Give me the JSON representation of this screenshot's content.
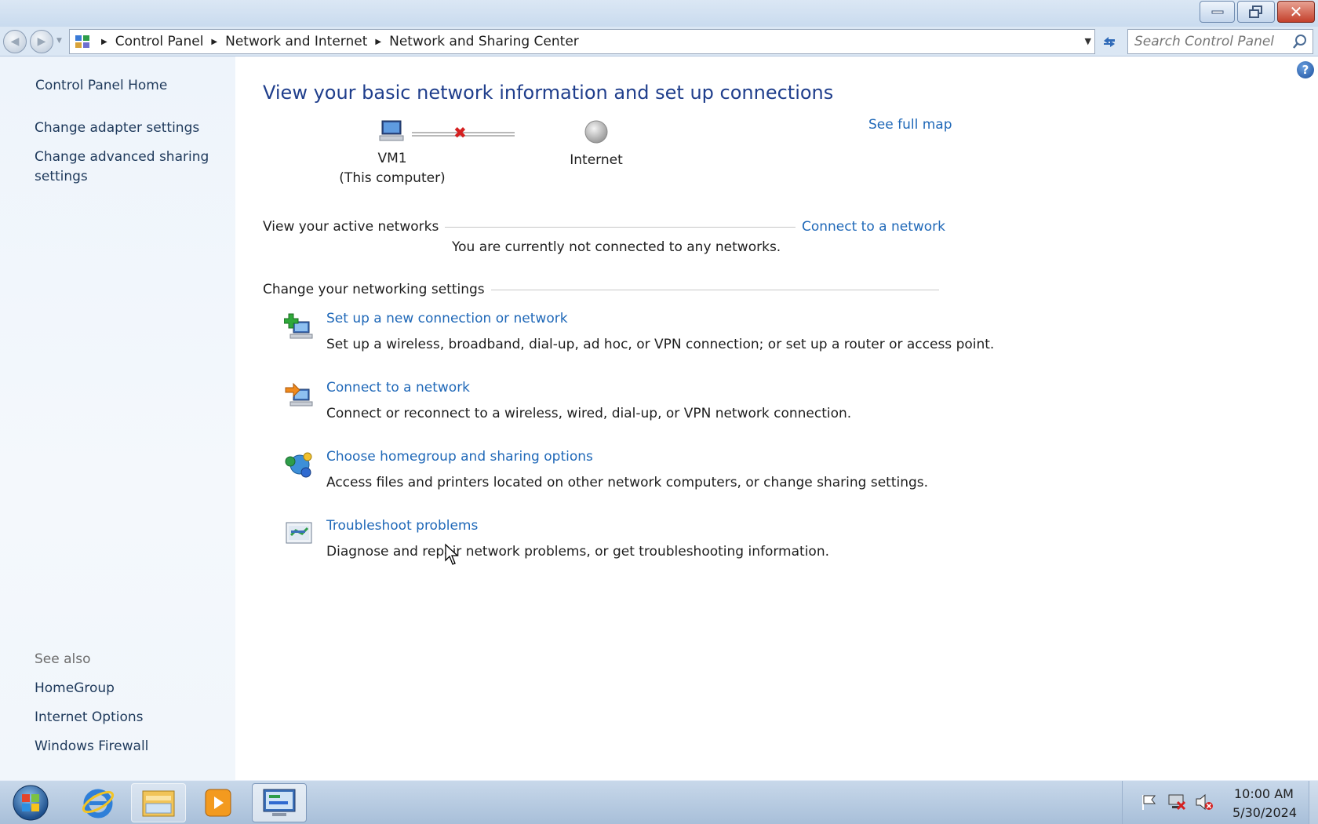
{
  "window": {
    "close_glyph": "✕"
  },
  "address_bar": {
    "breadcrumbs": [
      "Control Panel",
      "Network and Internet",
      "Network and Sharing Center"
    ],
    "search_placeholder": "Search Control Panel"
  },
  "sidebar": {
    "home": "Control Panel Home",
    "links": [
      "Change adapter settings",
      "Change advanced sharing settings"
    ],
    "see_also_label": "See also",
    "see_also": [
      "HomeGroup",
      "Internet Options",
      "Windows Firewall"
    ]
  },
  "main": {
    "title": "View your basic network information and set up connections",
    "see_full_map": "See full map",
    "map": {
      "computer_name": "VM1",
      "computer_sub": "(This computer)",
      "internet_label": "Internet",
      "status": "disconnected"
    },
    "active_networks_label": "View your active networks",
    "connect_link": "Connect to a network",
    "not_connected": "You are currently not connected to any networks.",
    "settings_label": "Change your networking settings",
    "tasks": [
      {
        "icon": "new-connection-icon",
        "link": "Set up a new connection or network",
        "desc": "Set up a wireless, broadband, dial-up, ad hoc, or VPN connection; or set up a router or access point."
      },
      {
        "icon": "connect-network-icon",
        "link": "Connect to a network",
        "desc": "Connect or reconnect to a wireless, wired, dial-up, or VPN network connection."
      },
      {
        "icon": "homegroup-icon",
        "link": "Choose homegroup and sharing options",
        "desc": "Access files and printers located on other network computers, or change sharing settings."
      },
      {
        "icon": "troubleshoot-icon",
        "link": "Troubleshoot problems",
        "desc": "Diagnose and repair network problems, or get troubleshooting information."
      }
    ]
  },
  "taskbar": {
    "time": "10:00 AM",
    "date": "5/30/2024"
  },
  "colors": {
    "link": "#1f68b8",
    "title": "#1f3e8c",
    "sidebar_bg": "#eef4fb"
  }
}
